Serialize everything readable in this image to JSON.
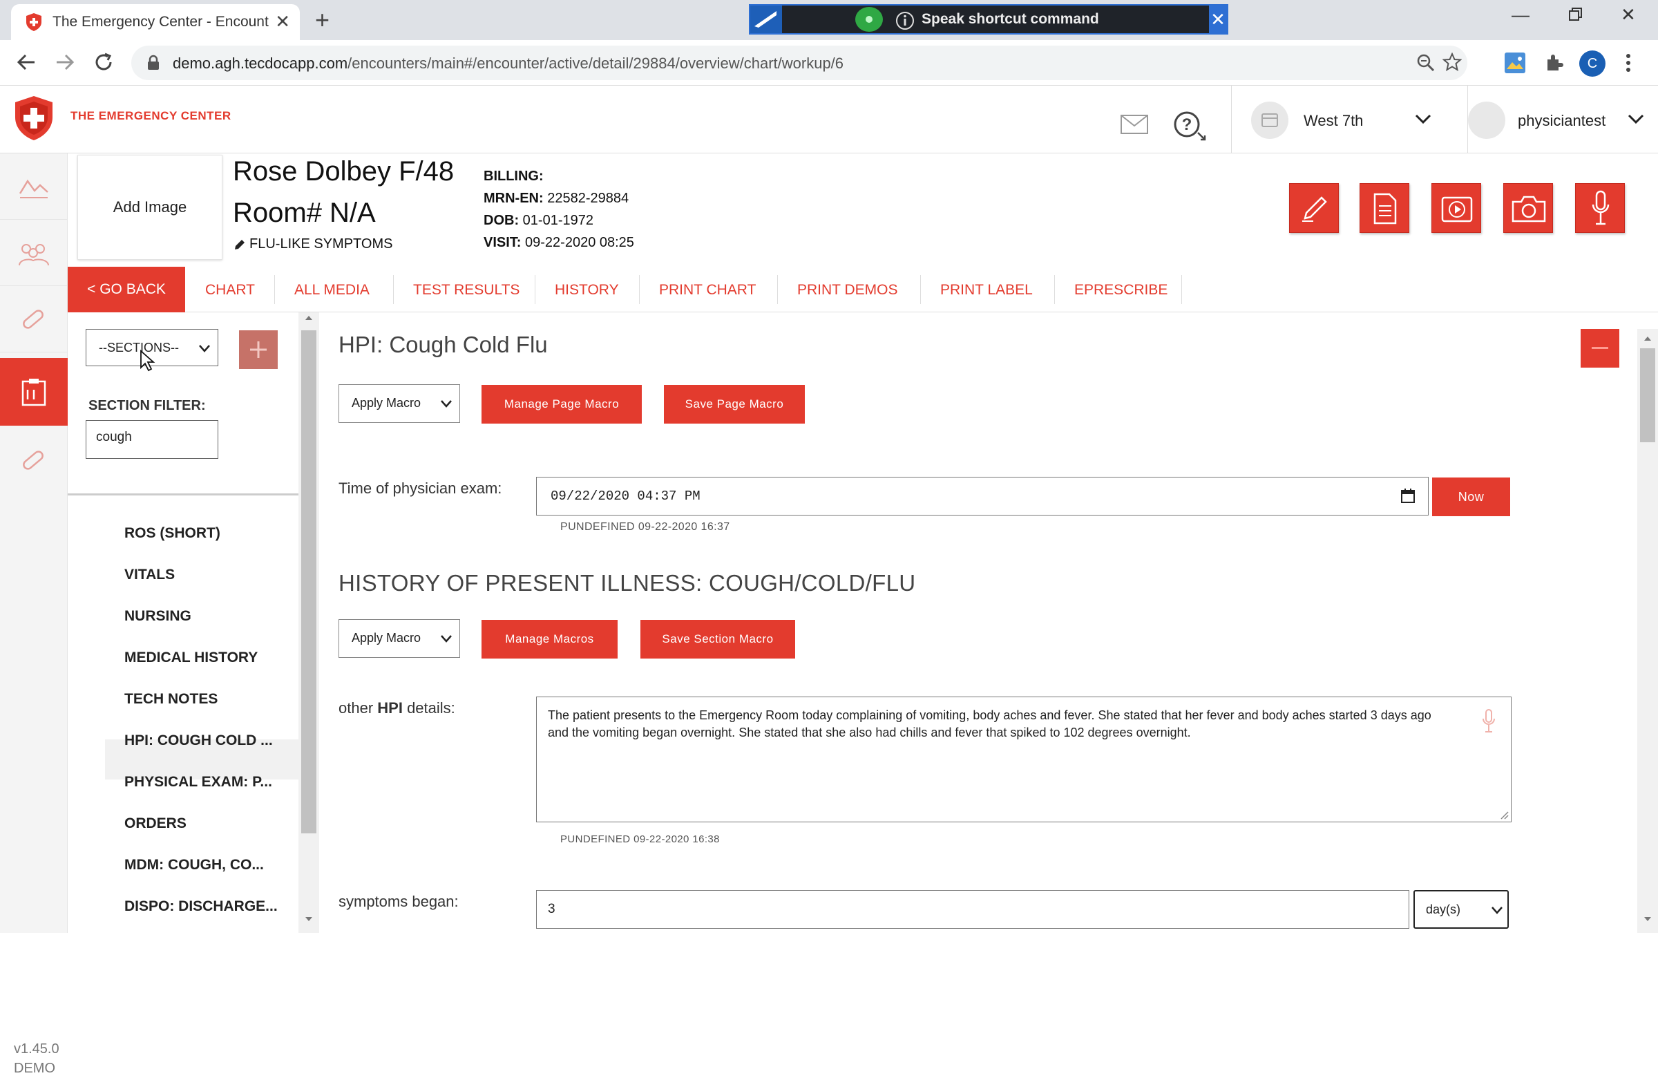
{
  "browser": {
    "tab_title": "The Emergency Center - Encount",
    "new_tab": "+",
    "speak_text": "Speak shortcut command",
    "url_host": "demo.agh.tecdocapp.com",
    "url_path": "/encounters/main#/encounter/active/detail/29884/overview/chart/workup/6",
    "profile_letter": "C"
  },
  "header": {
    "brand": "THE EMERGENCY CENTER",
    "location": "West 7th",
    "user": "physiciantest"
  },
  "patient": {
    "add_image": "Add Image",
    "name": "Rose Dolbey F/48",
    "room": "Room# N/A",
    "complaint": "FLU-LIKE SYMPTOMS",
    "billing_label": "BILLING:",
    "mrn_label": "MRN-EN:",
    "mrn": "22582-29884",
    "dob_label": "DOB:",
    "dob": "01-01-1972",
    "visit_label": "VISIT:",
    "visit": "09-22-2020 08:25"
  },
  "nav": {
    "back": "< GO BACK",
    "tabs": [
      "CHART",
      "ALL MEDIA",
      "TEST RESULTS",
      "HISTORY",
      "PRINT CHART",
      "PRINT DEMOS",
      "PRINT LABEL",
      "EPRESCRIBE"
    ]
  },
  "sections": {
    "select": "--SECTIONS--",
    "filter_label": "SECTION FILTER:",
    "filter_value": "cough",
    "items": [
      "ROS (SHORT)",
      "VITALS",
      "NURSING",
      "MEDICAL HISTORY",
      "TECH NOTES",
      "HPI: COUGH COLD ...",
      "PHYSICAL EXAM: P...",
      "ORDERS",
      "MDM: COUGH, CO...",
      "DISPO: DISCHARGE..."
    ],
    "active_index": 5
  },
  "version": {
    "number": "v1.45.0",
    "env": "DEMO"
  },
  "main": {
    "page_title": "HPI: Cough Cold Flu",
    "apply_macro": "Apply Macro",
    "manage_page_macro": "Manage Page Macro",
    "save_page_macro": "Save Page Macro",
    "exam_label": "Time of physician exam:",
    "exam_value": "09/22/2020 04:37 PM",
    "now": "Now",
    "exam_meta": "PUNDEFINED 09-22-2020 16:37",
    "section_title": "HISTORY OF PRESENT ILLNESS: COUGH/COLD/FLU",
    "apply_macro2": "Apply Macro",
    "manage_macros": "Manage Macros",
    "save_section_macro": "Save Section Macro",
    "hpi_label_pre": "other ",
    "hpi_label_bold": "HPI",
    "hpi_label_post": " details:",
    "hpi_text": "The patient presents to the Emergency Room today complaining of vomiting, body aches and fever. She stated that her fever and body aches started 3 days ago and the vomiting began overnight. She stated that she also had chills and fever that spiked to 102 degrees overnight.",
    "hpi_meta": "PUNDEFINED 09-22-2020 16:38",
    "symptoms_label": "symptoms began:",
    "symptoms_value": "3",
    "symptoms_unit": "day(s)"
  },
  "colors": {
    "accent": "#e33b2e"
  }
}
